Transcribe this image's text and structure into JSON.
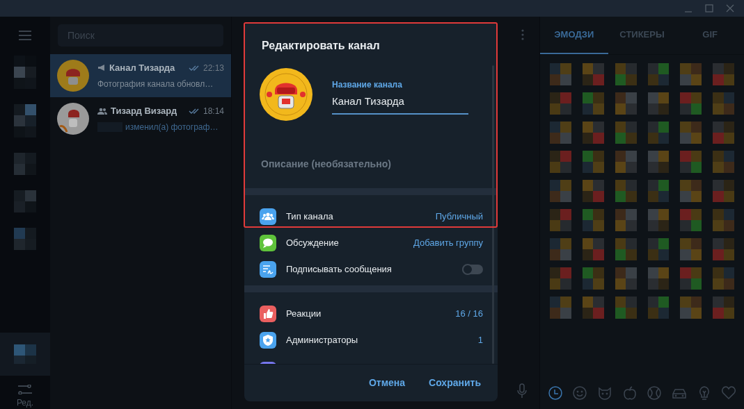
{
  "folders": {
    "edit_label": "Ред."
  },
  "search": {
    "placeholder": "Поиск"
  },
  "chats": [
    {
      "kind": "channel",
      "name": "Канал Тизарда",
      "time": "22:13",
      "preview": "Фотография канала обновл…",
      "preview_hidden_sender": false,
      "selected": true
    },
    {
      "kind": "group",
      "name": "Тизард Визард",
      "time": "18:14",
      "preview": "изменил(а) фотограф…",
      "preview_hidden_sender": true,
      "selected": false
    }
  ],
  "dialog": {
    "title": "Редактировать канал",
    "name_field": {
      "label": "Название канала",
      "value": "Канал Тизарда"
    },
    "description": {
      "placeholder": "Описание (необязательно)"
    },
    "sections": [
      [
        {
          "kind": "value",
          "label": "Тип канала",
          "value": "Публичный"
        },
        {
          "kind": "value",
          "label": "Обсуждение",
          "value": "Добавить группу"
        },
        {
          "kind": "toggle",
          "label": "Подписывать сообщения",
          "on": false
        }
      ],
      [
        {
          "kind": "value",
          "label": "Реакции",
          "value": "16 / 16"
        },
        {
          "kind": "value",
          "label": "Администраторы",
          "value": "1"
        },
        {
          "kind": "partial"
        }
      ]
    ],
    "highlight_frame": true,
    "buttons": [
      "Отмена",
      "Сохранить"
    ]
  },
  "emoji_panel": {
    "tabs": [
      {
        "label": "ЭМОДЗИ",
        "selected": true
      },
      {
        "label": "СТИКЕРЫ",
        "selected": false
      },
      {
        "label": "GIF",
        "selected": false
      }
    ],
    "categories": [
      {
        "kind": "recent",
        "selected": true
      },
      {
        "kind": "smileys",
        "selected": false
      },
      {
        "kind": "animals",
        "selected": false
      },
      {
        "kind": "food",
        "selected": false
      },
      {
        "kind": "sports",
        "selected": false
      },
      {
        "kind": "travel",
        "selected": false
      },
      {
        "kind": "objects",
        "selected": false
      },
      {
        "kind": "symbols",
        "selected": false
      }
    ]
  }
}
